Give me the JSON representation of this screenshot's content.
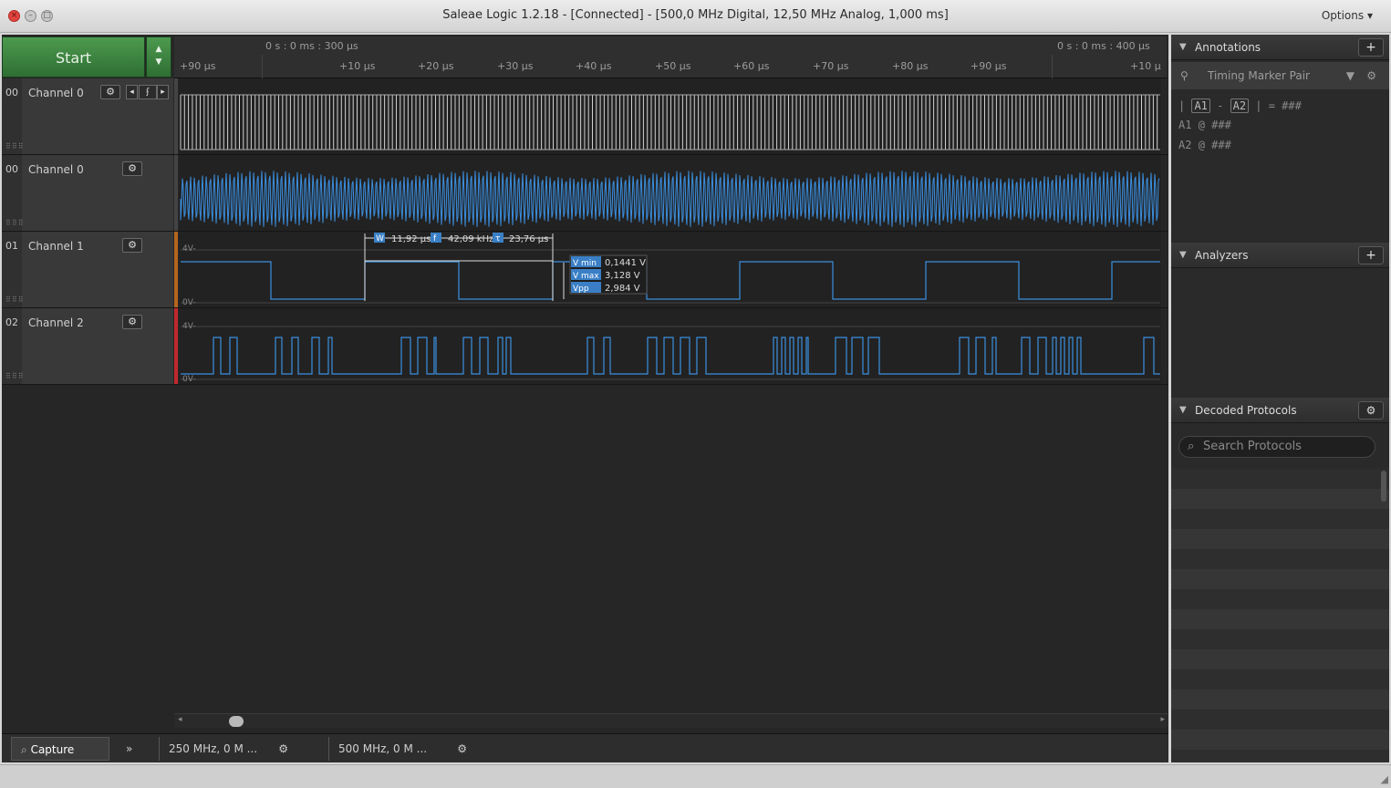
{
  "window": {
    "title": "Saleae Logic 1.2.18 - [Connected] - [500,0 MHz Digital, 12,50 MHz Analog, 1,000 ms]",
    "options_label": "Options"
  },
  "toolbar": {
    "start_label": "Start"
  },
  "timeline": {
    "left_time": "0 s : 0 ms : 300 µs",
    "right_time": "0 s : 0 ms : 400 µs",
    "ticks": [
      "+90 µs",
      "+10 µs",
      "+20 µs",
      "+30 µs",
      "+40 µs",
      "+50 µs",
      "+60 µs",
      "+70 µs",
      "+80 µs",
      "+90 µs",
      "+10 µ"
    ]
  },
  "channels": [
    {
      "num": "00",
      "name": "Channel 0",
      "type": "digital",
      "color": "#4a4a4a"
    },
    {
      "num": "00",
      "name": "Channel 0",
      "type": "analog",
      "color": "#4a4a4a"
    },
    {
      "num": "01",
      "name": "Channel 1",
      "type": "analog",
      "color": "#b5651d"
    },
    {
      "num": "02",
      "name": "Channel 2",
      "type": "analog",
      "color": "#c0282d"
    }
  ],
  "measurements": {
    "width_label": "W",
    "width": "11,92 µs",
    "freq_label": "f",
    "freq": "42,09 kHz",
    "period_label": "τ",
    "period": "23,76 µs",
    "vmin_label": "V min",
    "vmin": "0,1441 V",
    "vmax_label": "V max",
    "vmax": "3,128 V",
    "vpp_label": "Vpp",
    "vpp": "2,984 V"
  },
  "axis_labels": {
    "high": "4V-",
    "low": "0V-"
  },
  "sidebar": {
    "annotations": {
      "title": "Annotations",
      "marker": "Timing Marker Pair",
      "a1": "A1",
      "a2": "A2",
      "diff_value": "= ###",
      "a1_line": "@ ###",
      "a2_line": "@ ###"
    },
    "analyzers": {
      "title": "Analyzers"
    },
    "decoded": {
      "title": "Decoded Protocols",
      "search_placeholder": "Search Protocols"
    }
  },
  "bottom": {
    "capture_tab": "Capture",
    "session1": "250 MHz, 0 M ...",
    "session2": "500 MHz, 0 M ..."
  },
  "colors": {
    "accent_green": "#3f8a42",
    "wave_blue": "#3b8fe0",
    "digital_gray": "#cfcfcf"
  }
}
